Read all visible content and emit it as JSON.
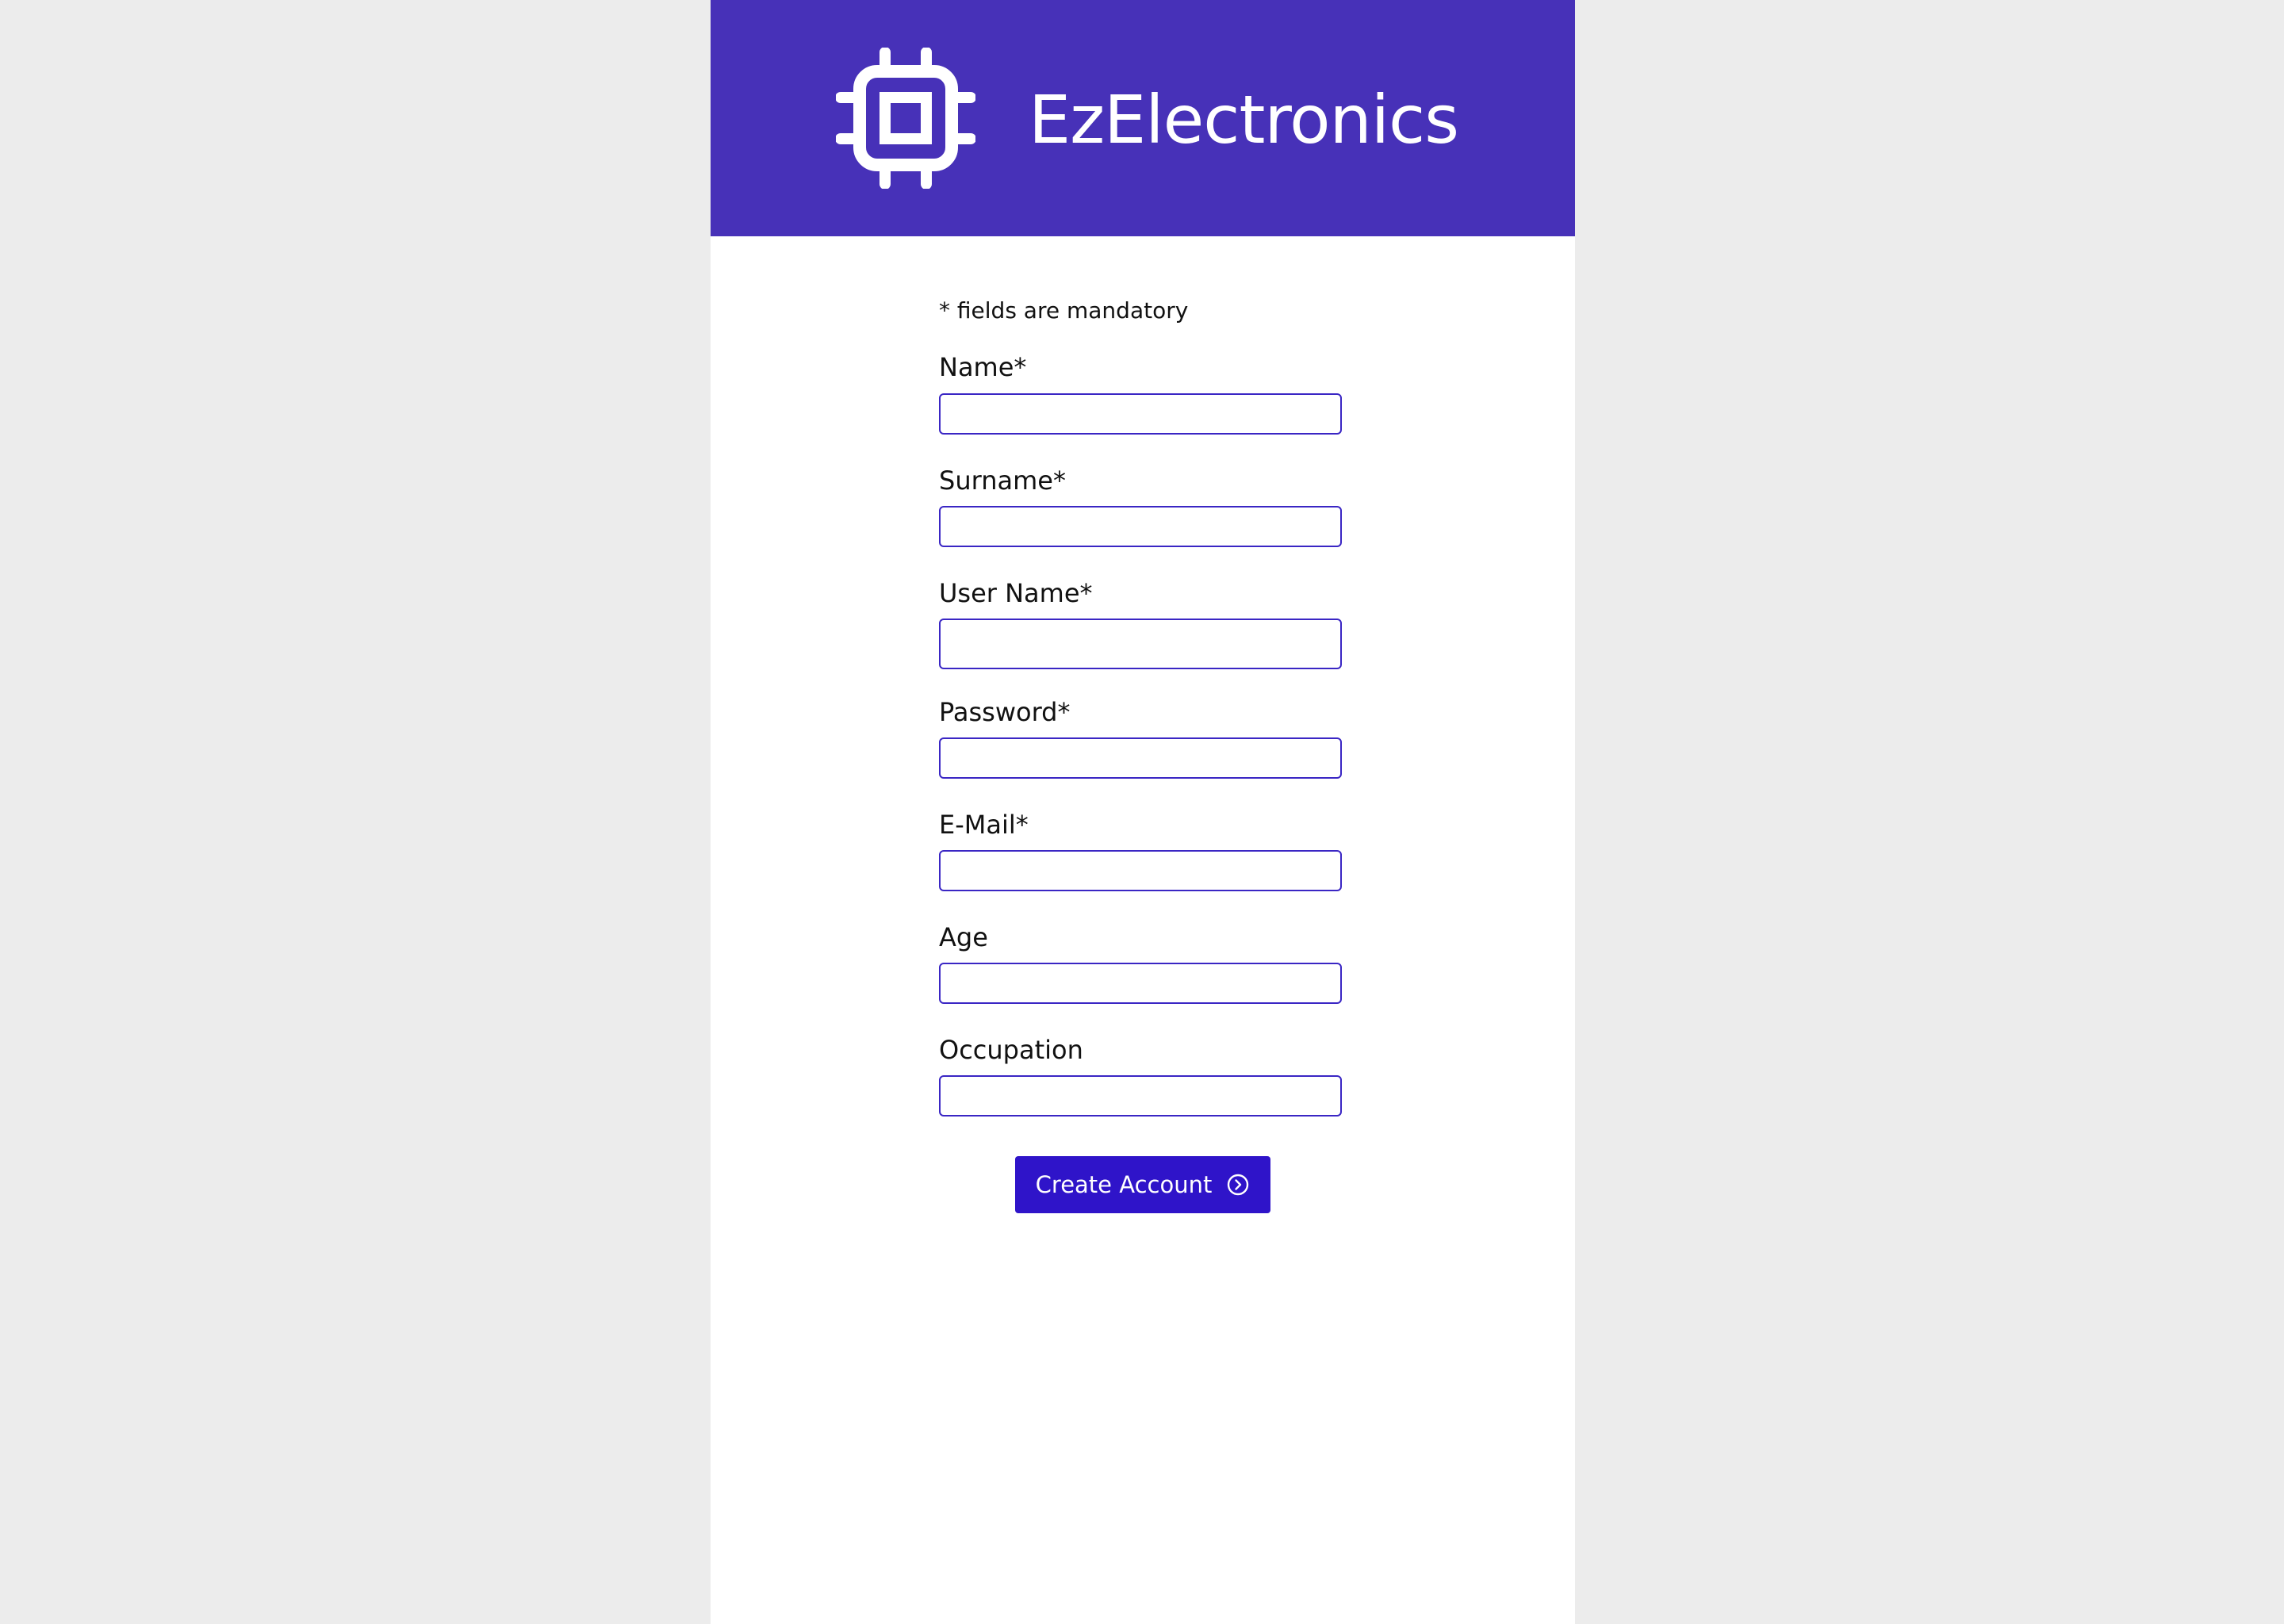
{
  "app": {
    "brand": "EzElectronics",
    "brand_icon": "cpu-chip-icon"
  },
  "form": {
    "mandatory_note": "* fields are mandatory",
    "fields": [
      {
        "label": "Name*",
        "value": "",
        "placeholder": ""
      },
      {
        "label": "Surname*",
        "value": "",
        "placeholder": ""
      },
      {
        "label": "User Name*",
        "value": "",
        "placeholder": ""
      },
      {
        "label": "Password*",
        "value": "",
        "placeholder": ""
      },
      {
        "label": "E-Mail*",
        "value": "",
        "placeholder": ""
      },
      {
        "label": "Age",
        "value": "",
        "placeholder": ""
      },
      {
        "label": "Occupation",
        "value": "",
        "placeholder": ""
      }
    ],
    "submit_label": "Create Account",
    "submit_icon": "circle-chevron-right-icon"
  },
  "colors": {
    "header_bg": "#4731b8",
    "accent": "#2f14c9",
    "field_border": "#3a26c4",
    "page_bg": "#ececec"
  }
}
